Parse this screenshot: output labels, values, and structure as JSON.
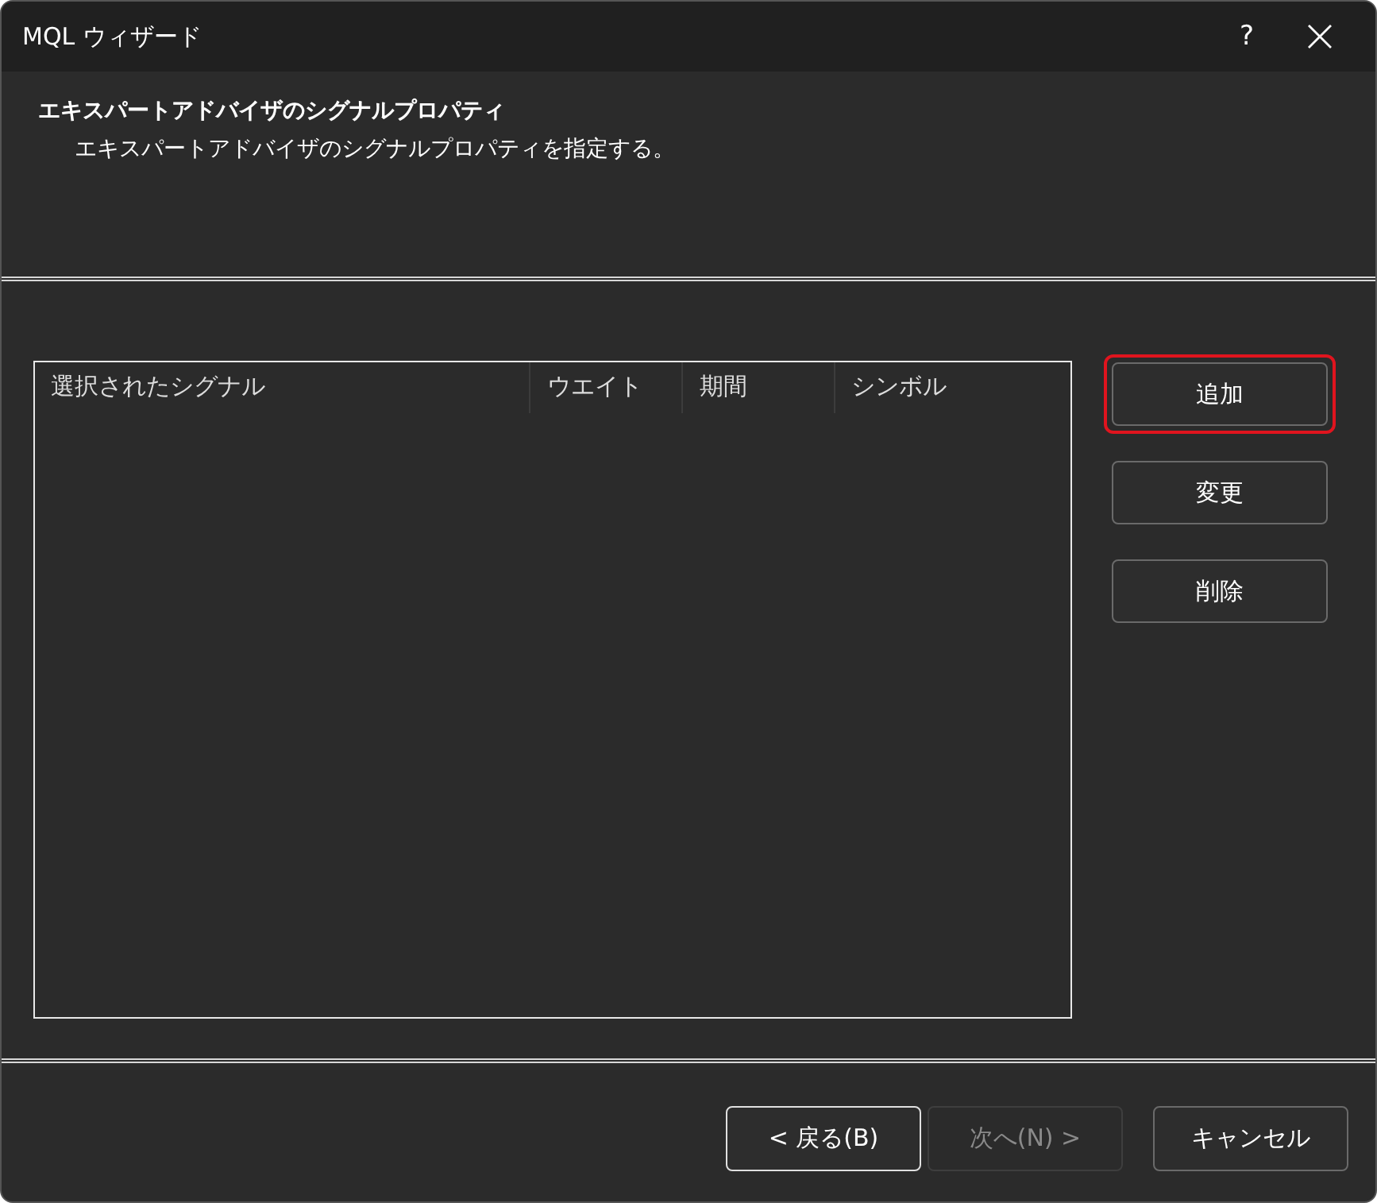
{
  "window": {
    "title": "MQL ウィザード",
    "help": "?"
  },
  "header": {
    "title": "エキスパートアドバイザのシグナルプロパティ",
    "subtitle": "エキスパートアドバイザのシグナルプロパティを指定する。"
  },
  "table": {
    "columns": [
      "選択されたシグナル",
      "ウエイト",
      "期間",
      "シンボル"
    ]
  },
  "side_buttons": [
    {
      "label": "追加",
      "highlighted": true
    },
    {
      "label": "変更",
      "highlighted": false
    },
    {
      "label": "削除",
      "highlighted": false
    }
  ],
  "footer_buttons": [
    {
      "label": "< 戻る(B)",
      "disabled": false,
      "focused": true
    },
    {
      "label": "次へ(N) >",
      "disabled": true,
      "focused": false
    },
    {
      "label": "キャンセル",
      "disabled": false,
      "focused": false
    }
  ]
}
